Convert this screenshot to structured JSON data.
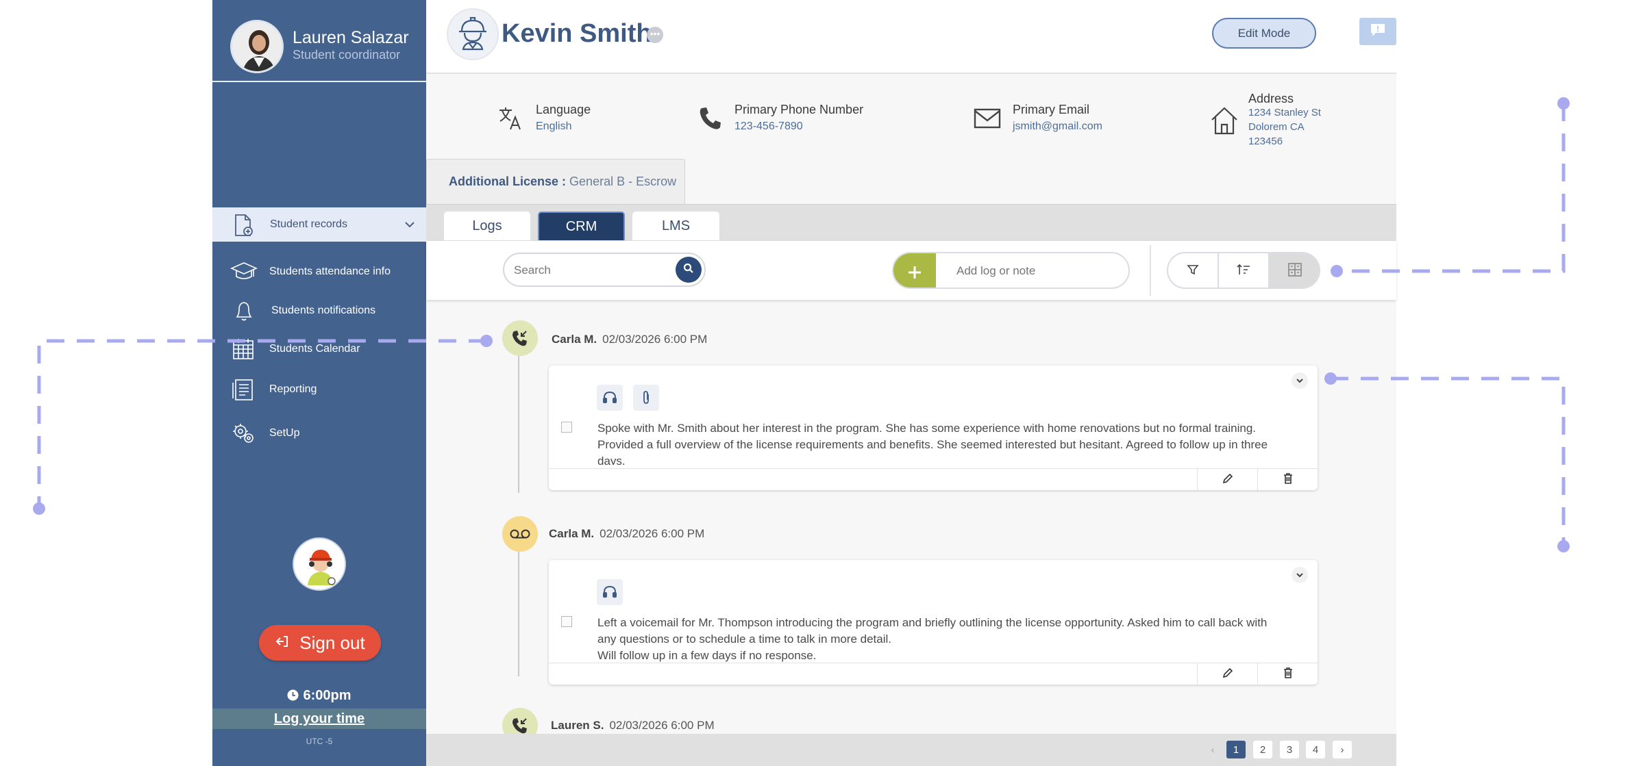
{
  "sidebar": {
    "user": {
      "name": "Lauren Salazar",
      "role": "Student coordinator"
    },
    "group": {
      "label": "Student records",
      "icon": "document-add-icon"
    },
    "items": [
      {
        "label": "Students attendance info",
        "icon": "graduation-cap-icon"
      },
      {
        "label": "Students notifications",
        "icon": "bell-icon"
      },
      {
        "label": "Students Calendar",
        "icon": "calendar-icon"
      },
      {
        "label": "Reporting",
        "icon": "report-icon"
      },
      {
        "label": "SetUp",
        "icon": "gears-icon"
      }
    ],
    "sign_out": "Sign out",
    "time": "6:00pm",
    "log_time": "Log your time",
    "timezone": "UTC -5"
  },
  "header": {
    "name": "Kevin Smith",
    "edit_mode": "Edit Mode"
  },
  "info": {
    "language": {
      "label": "Language",
      "value": "English"
    },
    "phone": {
      "label": "Primary Phone Number",
      "value": "123-456-7890"
    },
    "email": {
      "label": "Primary Email",
      "value": "jsmith@gmail.com"
    },
    "address": {
      "label": "Address",
      "line1": "1234 Stanley St",
      "line2": "Dolorem  CA",
      "line3": "123456"
    }
  },
  "license": {
    "key": "Additional License :",
    "value": "General B - Escrow"
  },
  "tabs": [
    {
      "label": "Logs",
      "active": false
    },
    {
      "label": "CRM",
      "active": true
    },
    {
      "label": "LMS",
      "active": false
    }
  ],
  "toolbar": {
    "search_placeholder": "Search",
    "add_placeholder": "Add log or note"
  },
  "entries": [
    {
      "author": "Carla M.",
      "date": "02/03/2026",
      "time": "6:00 PM",
      "type": "incoming-call-icon",
      "text": "Spoke with Mr. Smith about her interest in the program. She has some experience with home renovations but no formal training. Provided a full overview of the license requirements and benefits. She seemed interested but hesitant. Agreed to follow up in three days."
    },
    {
      "author": "Carla M.",
      "date": "02/03/2026",
      "time": "6:00 PM",
      "type": "voicemail-icon",
      "text": "Left a voicemail for Mr. Thompson introducing the program and briefly outlining the license opportunity. Asked him to call back with any questions or to schedule a time to talk in more detail.",
      "text2": "Will follow up in a few days if no response."
    },
    {
      "author": "Lauren S.",
      "date": "02/03/2026",
      "time": "6:00 PM",
      "type": "incoming-call-icon"
    }
  ],
  "pagination": {
    "pages": [
      "1",
      "2",
      "3",
      "4"
    ],
    "current": "1"
  },
  "colors": {
    "sidebar": "#43628e",
    "accent_green": "#aab844",
    "signout": "#e5503c",
    "tab_active": "#223e67",
    "connector": "#a9a9f0"
  }
}
